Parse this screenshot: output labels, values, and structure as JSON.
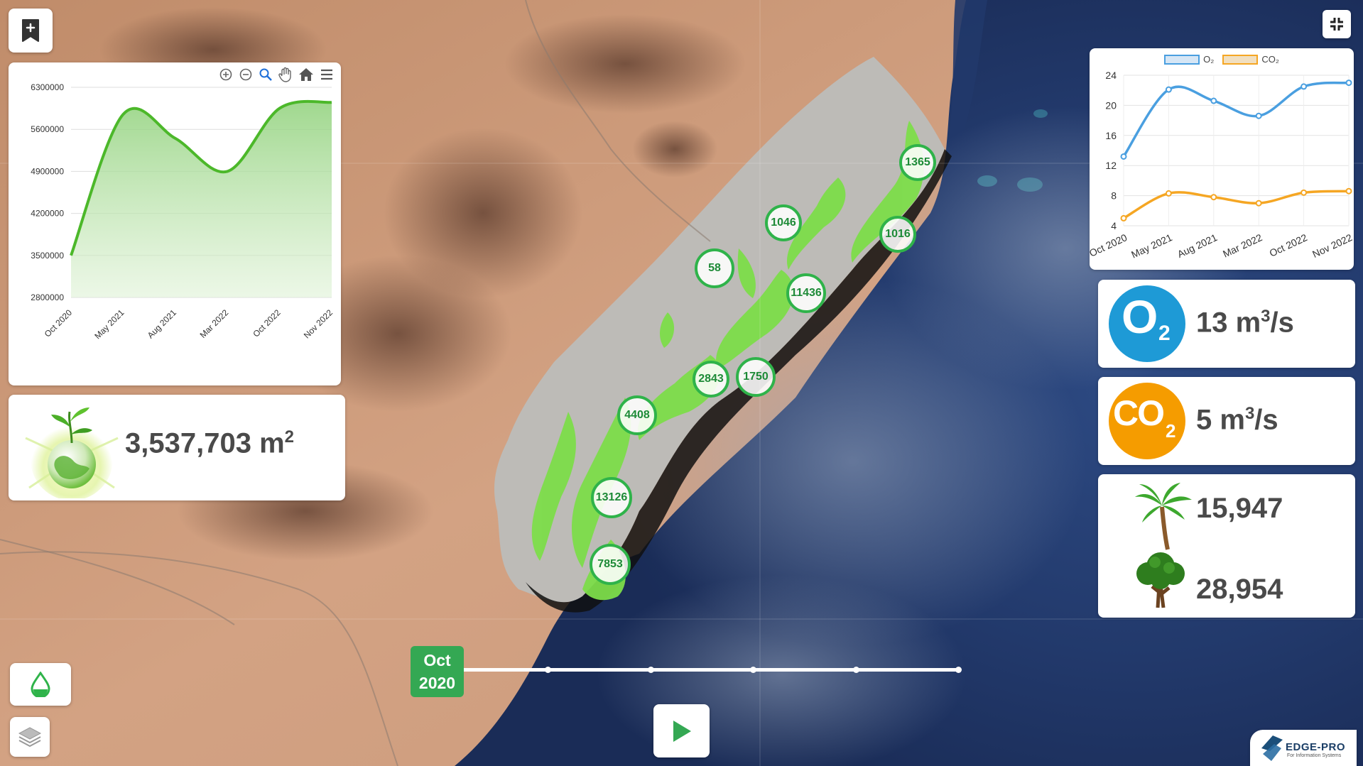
{
  "area_chart": {
    "toolbar_icons": [
      "zoom-in-icon",
      "zoom-out-icon",
      "magnify-icon",
      "pan-hand-icon",
      "home-icon",
      "menu-icon"
    ],
    "color": "#4cb82a"
  },
  "area_stat": {
    "value": "3,537,703 m",
    "unit_sup": "2"
  },
  "line_chart": {
    "legend": [
      {
        "label": "O₂",
        "color": "#4a9fe0"
      },
      {
        "label": "CO₂",
        "color": "#f5a623"
      }
    ]
  },
  "o2_card": {
    "symbol": "O",
    "sub": "2",
    "value": "13 m",
    "sup": "3",
    "unit_rest": "/s",
    "color": "#1e9ad6"
  },
  "co2_card": {
    "symbol": "CO",
    "sub": "2",
    "value": "5 m",
    "sup": "3",
    "unit_rest": "/s",
    "color": "#f59c00"
  },
  "trees_card": {
    "palm_count": "15,947",
    "tree_count": "28,954"
  },
  "clusters": [
    "1365",
    "1046",
    "1016",
    "58",
    "11436",
    "2843",
    "1750",
    "4408",
    "13126",
    "7853"
  ],
  "timeline": {
    "month": "Oct",
    "year": "2020",
    "steps": 6,
    "current_index": 0
  },
  "brand": {
    "name": "EDGE-PRO",
    "tagline": "For Information Systems"
  },
  "chart_data": [
    {
      "type": "area",
      "categories": [
        "Oct 2020",
        "May 2021",
        "Aug 2021",
        "Mar 2022",
        "Oct 2022",
        "Nov 2022"
      ],
      "series": [
        {
          "values": [
            3500000,
            5850000,
            5450000,
            4900000,
            5950000,
            6050000
          ]
        }
      ],
      "yticks": [
        2800000,
        3500000,
        4200000,
        4900000,
        5600000,
        6300000
      ],
      "ylim": [
        2800000,
        6300000
      ],
      "grid": true
    },
    {
      "type": "line",
      "categories": [
        "Oct 2020",
        "May 2021",
        "Aug 2021",
        "Mar 2022",
        "Oct 2022",
        "Nov 2022"
      ],
      "series": [
        {
          "name": "O₂",
          "values": [
            13.2,
            22.1,
            20.6,
            18.6,
            22.5,
            23.0
          ],
          "color": "#4a9fe0"
        },
        {
          "name": "CO₂",
          "values": [
            5.0,
            8.3,
            7.8,
            7.0,
            8.4,
            8.6
          ],
          "color": "#f5a623"
        }
      ],
      "yticks": [
        4,
        8,
        12,
        16,
        20,
        24
      ],
      "ylim": [
        4,
        24
      ],
      "legend": "top-center"
    }
  ]
}
